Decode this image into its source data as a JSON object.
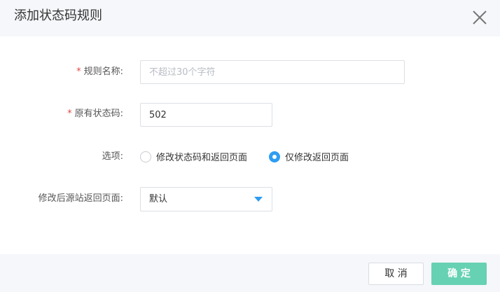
{
  "dialog": {
    "title": "添加状态码规则",
    "close_icon": "close-icon"
  },
  "form": {
    "required_mark": "*",
    "rule_name": {
      "label": "规则名称:",
      "value": "",
      "placeholder": "不超过30个字符"
    },
    "status_code": {
      "label": "原有状态码:",
      "value": "502"
    },
    "options": {
      "label": "选项:",
      "choices": [
        {
          "label": "修改状态码和返回页面",
          "selected": false
        },
        {
          "label": "仅修改返回页面",
          "selected": true
        }
      ]
    },
    "origin_page": {
      "label": "修改后源站返回页面:",
      "selected": "默认"
    }
  },
  "footer": {
    "cancel_label": "取 消",
    "ok_label": "确 定"
  },
  "colors": {
    "accent": "#2d9cf2",
    "confirm": "#66d1b3",
    "required": "#e64646"
  }
}
